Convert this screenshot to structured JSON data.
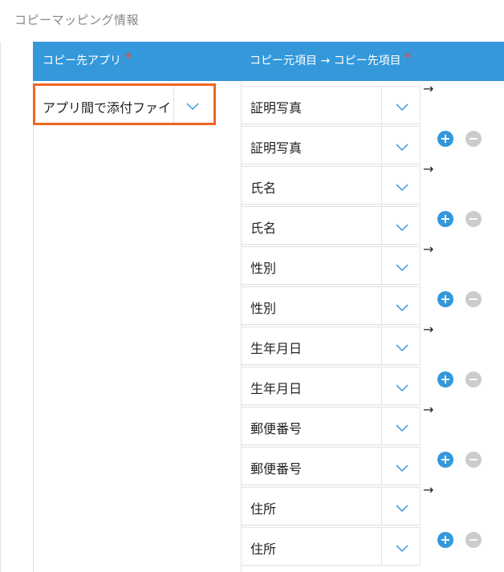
{
  "section_title": "コピーマッピング情報",
  "header": {
    "app_label": "コピー先アプリ",
    "mapping_label": "コピー元項目 → コピー先項目",
    "required_mark": "*"
  },
  "app_select": {
    "value": "アプリ間で添付ファイ"
  },
  "mappings": [
    {
      "source": "証明写真",
      "dest": "証明写真"
    },
    {
      "source": "氏名",
      "dest": "氏名"
    },
    {
      "source": "性別",
      "dest": "性別"
    },
    {
      "source": "生年月日",
      "dest": "生年月日"
    },
    {
      "source": "郵便番号",
      "dest": "郵便番号"
    },
    {
      "source": "住所",
      "dest": "住所"
    }
  ],
  "arrow": "→",
  "add_symbol": "+",
  "remove_symbol": "−",
  "colors": {
    "header": "#3498db",
    "required": "#e74c3c",
    "highlight": "#f26522",
    "remove": "#cccccc"
  }
}
